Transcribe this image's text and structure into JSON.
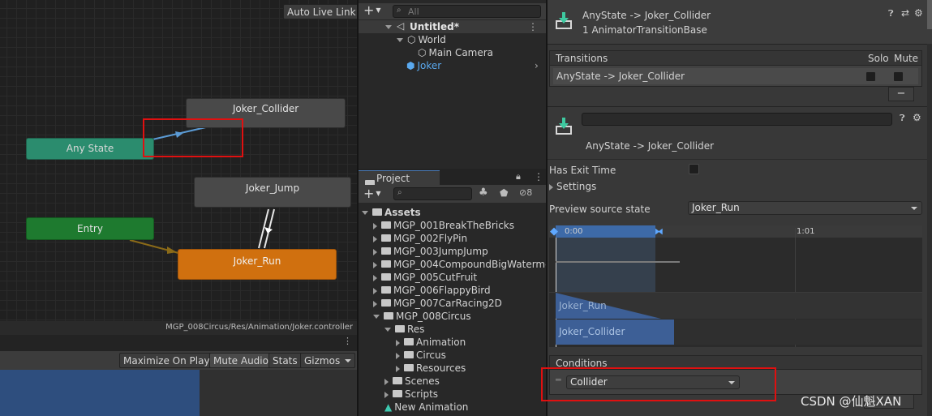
{
  "animator": {
    "auto_live_link": "Auto Live Link",
    "nodes": {
      "any_state": "Any State",
      "joker_collider": "Joker_Collider",
      "joker_jump": "Joker_Jump",
      "entry": "Entry",
      "joker_run": "Joker_Run"
    },
    "controller_path": "MGP_008Circus/Res/Animation/Joker.controller"
  },
  "game_toolbar": {
    "maximize_on_play": "Maximize On Play",
    "mute_audio": "Mute Audio",
    "stats": "Stats",
    "gizmos": "Gizmos"
  },
  "hierarchy": {
    "add": "+",
    "search_placeholder": "All",
    "scene": "Untitled*",
    "items": [
      "World",
      "Main Camera",
      "Joker"
    ]
  },
  "project": {
    "tab": "Project",
    "add": "+",
    "hidden_count": "8",
    "root": "Assets",
    "folders": [
      "MGP_001BreakTheBricks",
      "MGP_002FlyPin",
      "MGP_003JumpJump",
      "MGP_004CompoundBigWaterme",
      "MGP_005CutFruit",
      "MGP_006FlappyBird",
      "MGP_007CarRacing2D",
      "MGP_008Circus"
    ],
    "res": "Res",
    "res_children": [
      "Animation",
      "Circus",
      "Resources"
    ],
    "scenes": "Scenes",
    "scripts": "Scripts",
    "new_animation": "New Animation"
  },
  "inspector": {
    "header_title": "AnyState -> Joker_Collider",
    "header_sub": "1 AnimatorTransitionBase",
    "transitions_label": "Transitions",
    "solo": "Solo",
    "mute": "Mute",
    "transition_row": "AnyState -> Joker_Collider",
    "remove_btn": "−",
    "transition_name_field": "",
    "transition_caption": "AnyState -> Joker_Collider",
    "has_exit_time": "Has Exit Time",
    "settings": "Settings",
    "preview_source_label": "Preview source state",
    "preview_source_value": "Joker_Run",
    "timeline_start": "0:00",
    "timeline_mark": "1:01",
    "track_run": "Joker_Run",
    "track_collider": "Joker_Collider",
    "conditions_label": "Conditions",
    "condition_value": "Collider"
  },
  "watermark": "CSDN @仙魁XAN",
  "colors": {
    "highlight_red": "#e01010",
    "any_state_green": "#2b8c6e",
    "entry_green": "#1e7a2f",
    "state_orange": "#d0700f",
    "transition_blue": "#5b9bd5",
    "joker_blue": "#5aa9ef"
  }
}
